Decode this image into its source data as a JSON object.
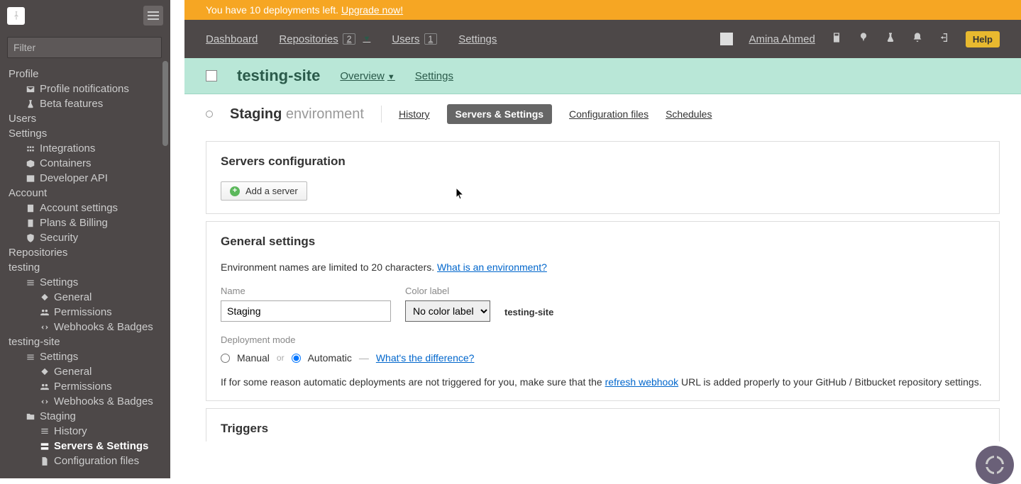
{
  "sidebar": {
    "filter_placeholder": "Filter",
    "groups": [
      {
        "label": "Profile",
        "items": [
          "Profile notifications",
          "Beta features"
        ]
      },
      {
        "label": "Users",
        "items": []
      },
      {
        "label": "Settings",
        "items": [
          "Integrations",
          "Containers",
          "Developer API"
        ]
      },
      {
        "label": "Account",
        "items": [
          "Account settings",
          "Plans & Billing",
          "Security"
        ]
      },
      {
        "label": "Repositories",
        "items": []
      },
      {
        "label": "testing",
        "items": [
          {
            "label": "Settings",
            "sub": [
              "General",
              "Permissions",
              "Webhooks & Badges"
            ]
          }
        ]
      },
      {
        "label": "testing-site",
        "items": [
          {
            "label": "Settings",
            "sub": [
              "General",
              "Permissions",
              "Webhooks & Badges"
            ]
          },
          {
            "label": "Staging",
            "sub": [
              "History",
              "Servers & Settings",
              "Configuration files"
            ],
            "active_sub": "Servers & Settings"
          }
        ]
      }
    ]
  },
  "banner": {
    "text": "You have 10 deployments left. ",
    "link": "Upgrade now!"
  },
  "topnav": {
    "dashboard": "Dashboard",
    "repositories": "Repositories",
    "repo_count": "2",
    "users": "Users",
    "user_count": "1",
    "settings": "Settings",
    "username": "Amina Ahmed",
    "help": "Help"
  },
  "repo_header": {
    "title": "testing-site",
    "overview": "Overview",
    "settings": "Settings"
  },
  "env_bar": {
    "name": "Staging",
    "suffix": "environment",
    "tabs": [
      "History",
      "Servers & Settings",
      "Configuration files",
      "Schedules"
    ],
    "active": "Servers & Settings"
  },
  "servers_panel": {
    "title": "Servers configuration",
    "add_btn": "Add a server"
  },
  "general": {
    "title": "General settings",
    "note_prefix": "Environment names are limited to 20 characters. ",
    "note_link": "What is an environment?",
    "name_label": "Name",
    "name_value": "Staging",
    "color_label": "Color label",
    "color_value": "No color label",
    "repo_name": "testing-site",
    "mode_label": "Deployment mode",
    "mode_manual": "Manual",
    "mode_or": "or",
    "mode_auto": "Automatic",
    "mode_selected": "Automatic",
    "mode_dash": "—",
    "mode_diff": "What's the difference?",
    "info_prefix": "If for some reason automatic deployments are not triggered for you, make sure that the ",
    "info_link": "refresh webhook",
    "info_suffix": " URL is added properly to your GitHub / Bitbucket repository settings."
  },
  "triggers": {
    "title": "Triggers"
  }
}
